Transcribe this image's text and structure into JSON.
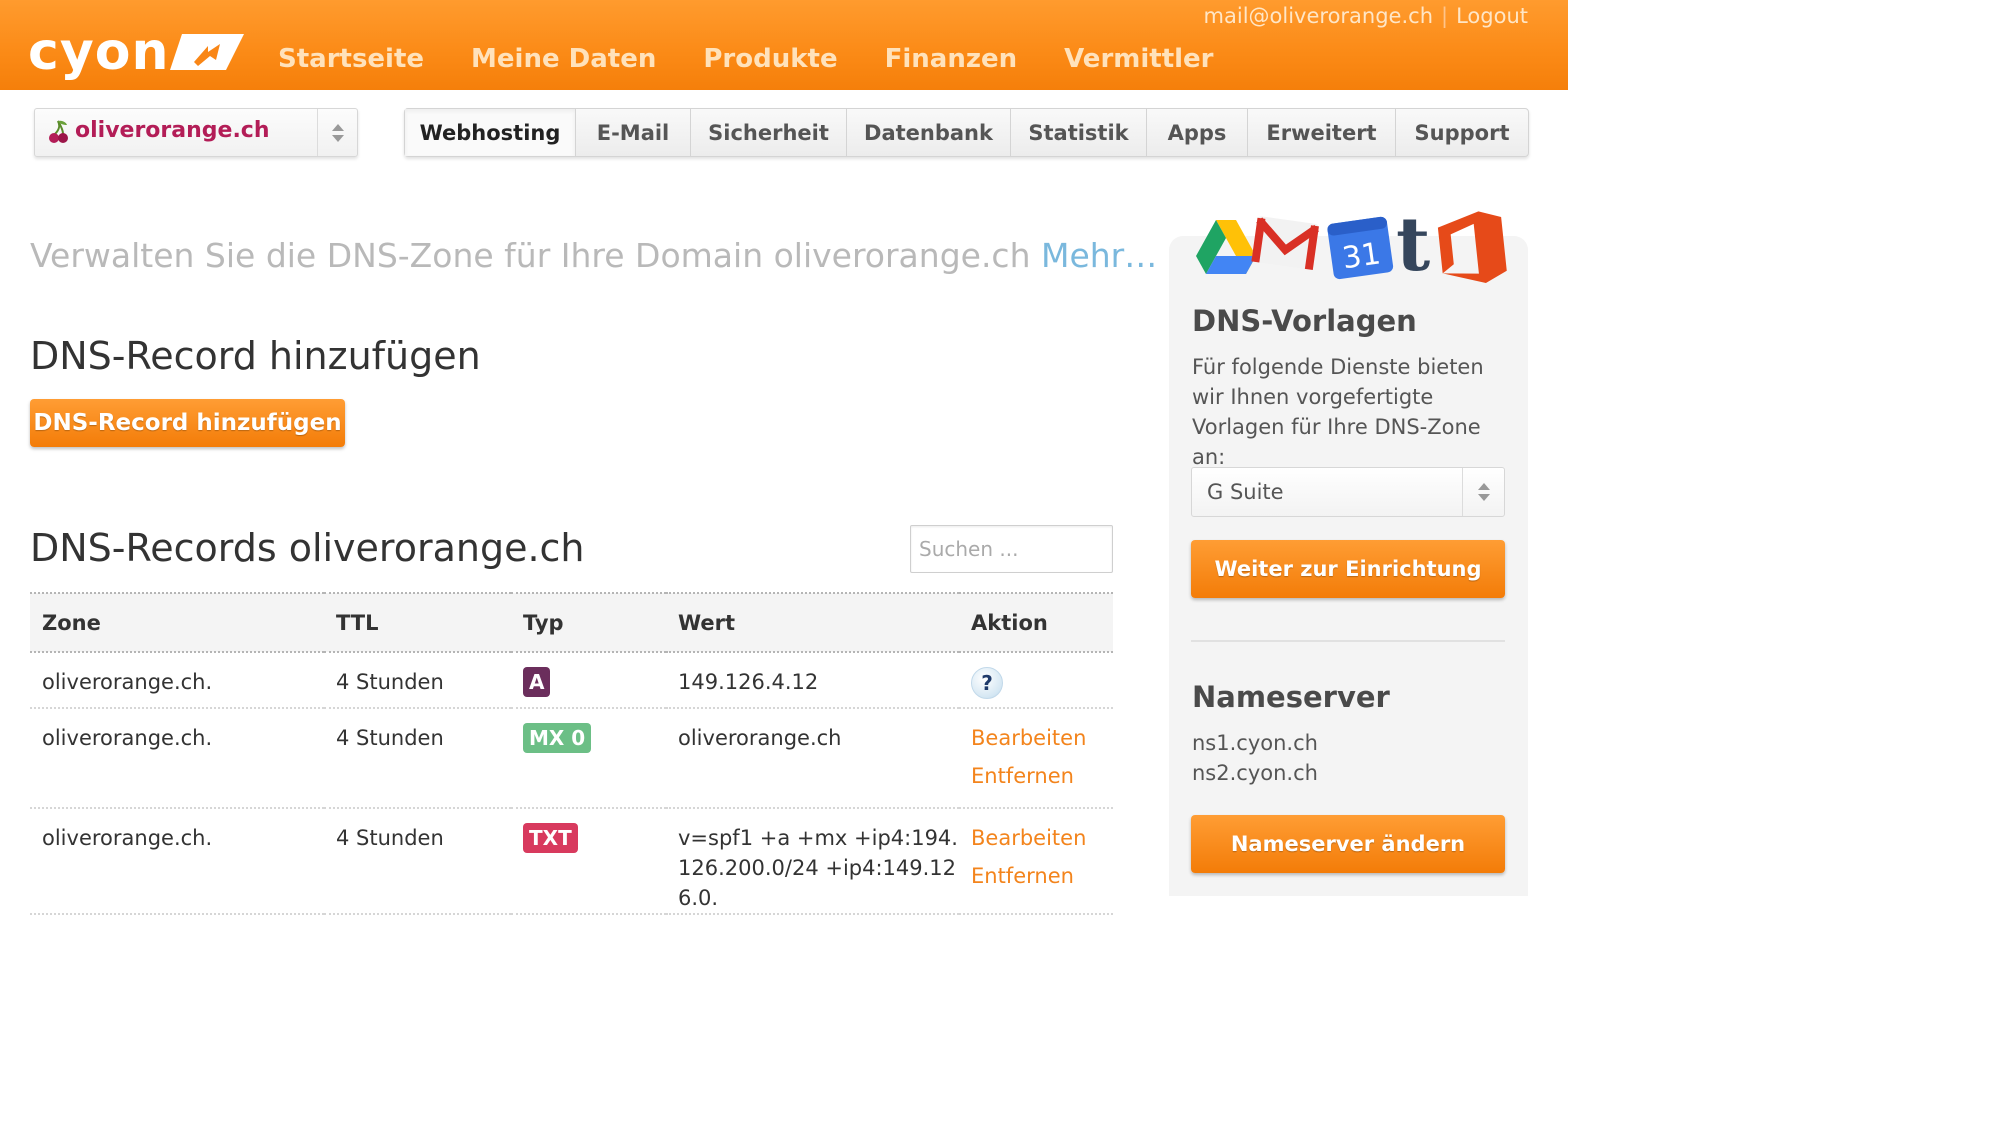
{
  "header": {
    "logo_text": "cyon",
    "nav": [
      "Startseite",
      "Meine Daten",
      "Produkte",
      "Finanzen",
      "Vermittler"
    ],
    "user_email": "mail@oliverorange.ch",
    "logout_label": "Logout"
  },
  "domain_select": {
    "selected": "oliverorange.ch"
  },
  "tabs": [
    {
      "label": "Webhosting",
      "active": true
    },
    {
      "label": "E-Mail"
    },
    {
      "label": "Sicherheit"
    },
    {
      "label": "Datenbank"
    },
    {
      "label": "Statistik"
    },
    {
      "label": "Apps"
    },
    {
      "label": "Erweitert"
    },
    {
      "label": "Support"
    }
  ],
  "main": {
    "intro_text": "Verwalten Sie die DNS-Zone für Ihre Domain oliverorange.ch ",
    "intro_more": "Mehr…",
    "add_heading": "DNS-Record hinzufügen",
    "add_button": "DNS-Record hinzufügen",
    "records_heading": "DNS-Records oliverorange.ch",
    "search_placeholder": "Suchen ...",
    "table": {
      "headers": [
        "Zone",
        "TTL",
        "Typ",
        "Wert",
        "Aktion"
      ],
      "rows": [
        {
          "zone": "oliverorange.ch.",
          "ttl": "4 Stunden",
          "type": "A",
          "value": "149.126.4.12",
          "action": "help"
        },
        {
          "zone": "oliverorange.ch.",
          "ttl": "4 Stunden",
          "type": "MX 0",
          "value": "oliverorange.ch",
          "edit": "Bearbeiten",
          "remove": "Entfernen"
        },
        {
          "zone": "oliverorange.ch.",
          "ttl": "4 Stunden",
          "type": "TXT",
          "value": "v=spf1 +a +mx +ip4:194.126.200.0/24 +ip4:149.126.0.",
          "edit": "Bearbeiten",
          "remove": "Entfernen"
        }
      ]
    }
  },
  "sidebar": {
    "templates_heading": "DNS-Vorlagen",
    "templates_text": "Für folgende Dienste bieten wir Ihnen vorgefertigte Vorlagen für Ihre DNS-Zone an:",
    "templates_select": "G Suite",
    "templates_button": "Weiter zur Einrichtung",
    "calendar_day": "31",
    "nameserver_heading": "Nameserver",
    "nameservers": [
      "ns1.cyon.ch",
      "ns2.cyon.ch"
    ],
    "nameserver_button": "Nameserver ändern"
  },
  "colors": {
    "brand_orange": "#f98616",
    "link_orange": "#f3841c",
    "domain_magenta": "#b31d57",
    "badge_a": "#6b2e5c",
    "badge_mx": "#6cbf86",
    "badge_txt": "#d83a5e",
    "more_link": "#7ab8dd"
  },
  "icons": {
    "help": "question-circle-icon",
    "domain": "cherry-icon",
    "select": "updown-arrows-icon"
  }
}
